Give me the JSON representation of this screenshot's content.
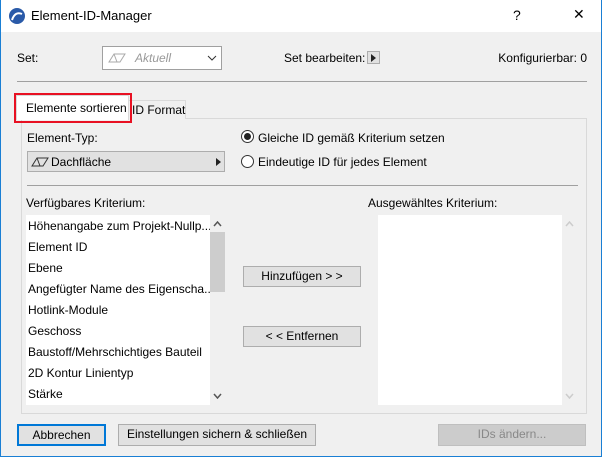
{
  "window": {
    "title": "Element-ID-Manager",
    "help": "?",
    "close": "✕"
  },
  "set": {
    "label": "Set:",
    "value": "Aktuell",
    "edit_label": "Set bearbeiten:",
    "configurable": "Konfigurierbar: 0"
  },
  "tabs": [
    {
      "label": "Elemente sortieren",
      "active": true
    },
    {
      "label": "ID Format",
      "active": false
    }
  ],
  "element_type": {
    "label": "Element-Typ:",
    "value": "Dachfläche"
  },
  "mode": {
    "options": [
      "Gleiche ID gemäß Kriterium setzen",
      "Eindeutige ID für jedes Element"
    ],
    "selected": 0
  },
  "available": {
    "label": "Verfügbares Kriterium:",
    "items": [
      "Höhenangabe zum Projekt-Nullp...",
      "Element ID",
      "Ebene",
      "Angefügter Name des Eigenscha...",
      "Hotlink-Module",
      "Geschoss",
      "Baustoff/Mehrschichtiges Bauteil",
      "2D Kontur Linientyp",
      "Stärke"
    ]
  },
  "selected": {
    "label": "Ausgewähltes Kriterium:",
    "items": []
  },
  "buttons": {
    "add": "Hinzufügen > >",
    "remove": "< < Entfernen",
    "cancel": "Abbrechen",
    "save": "Einstellungen sichern & schließen",
    "change": "IDs ändern..."
  }
}
